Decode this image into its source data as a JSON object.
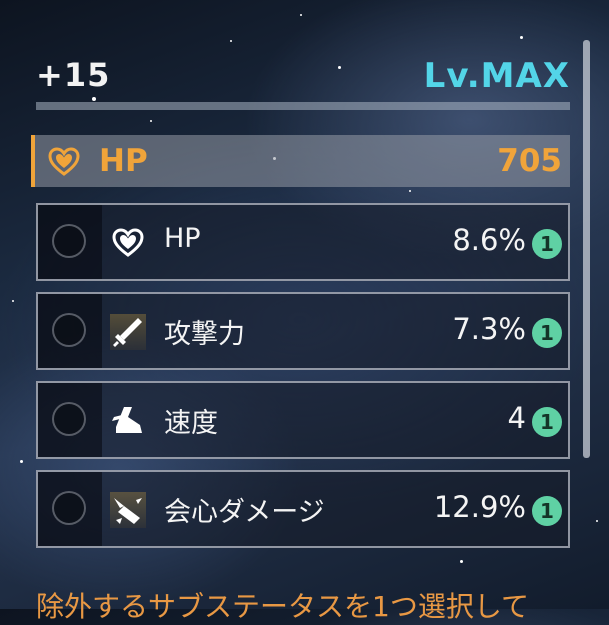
{
  "header": {
    "enhance_level": "+15",
    "level_status": "Lv.MAX"
  },
  "main_stat": {
    "icon": "heart-icon",
    "label": "HP",
    "value": "705"
  },
  "substats": [
    {
      "icon": "heart-icon",
      "label": "HP",
      "value": "8.6%",
      "rolls": "1"
    },
    {
      "icon": "sword-icon",
      "label": "攻撃力",
      "value": "7.3%",
      "rolls": "1"
    },
    {
      "icon": "boot-icon",
      "label": "速度",
      "value": "4",
      "rolls": "1"
    },
    {
      "icon": "crit-damage-icon",
      "label": "会心ダメージ",
      "value": "12.9%",
      "rolls": "1"
    }
  ],
  "footer": {
    "instruction": "除外するサブステータスを1つ選択して"
  },
  "colors": {
    "accent_orange": "#f0a43a",
    "level_cyan": "#53d5e8",
    "roll_badge_green": "#5fd1a4"
  }
}
